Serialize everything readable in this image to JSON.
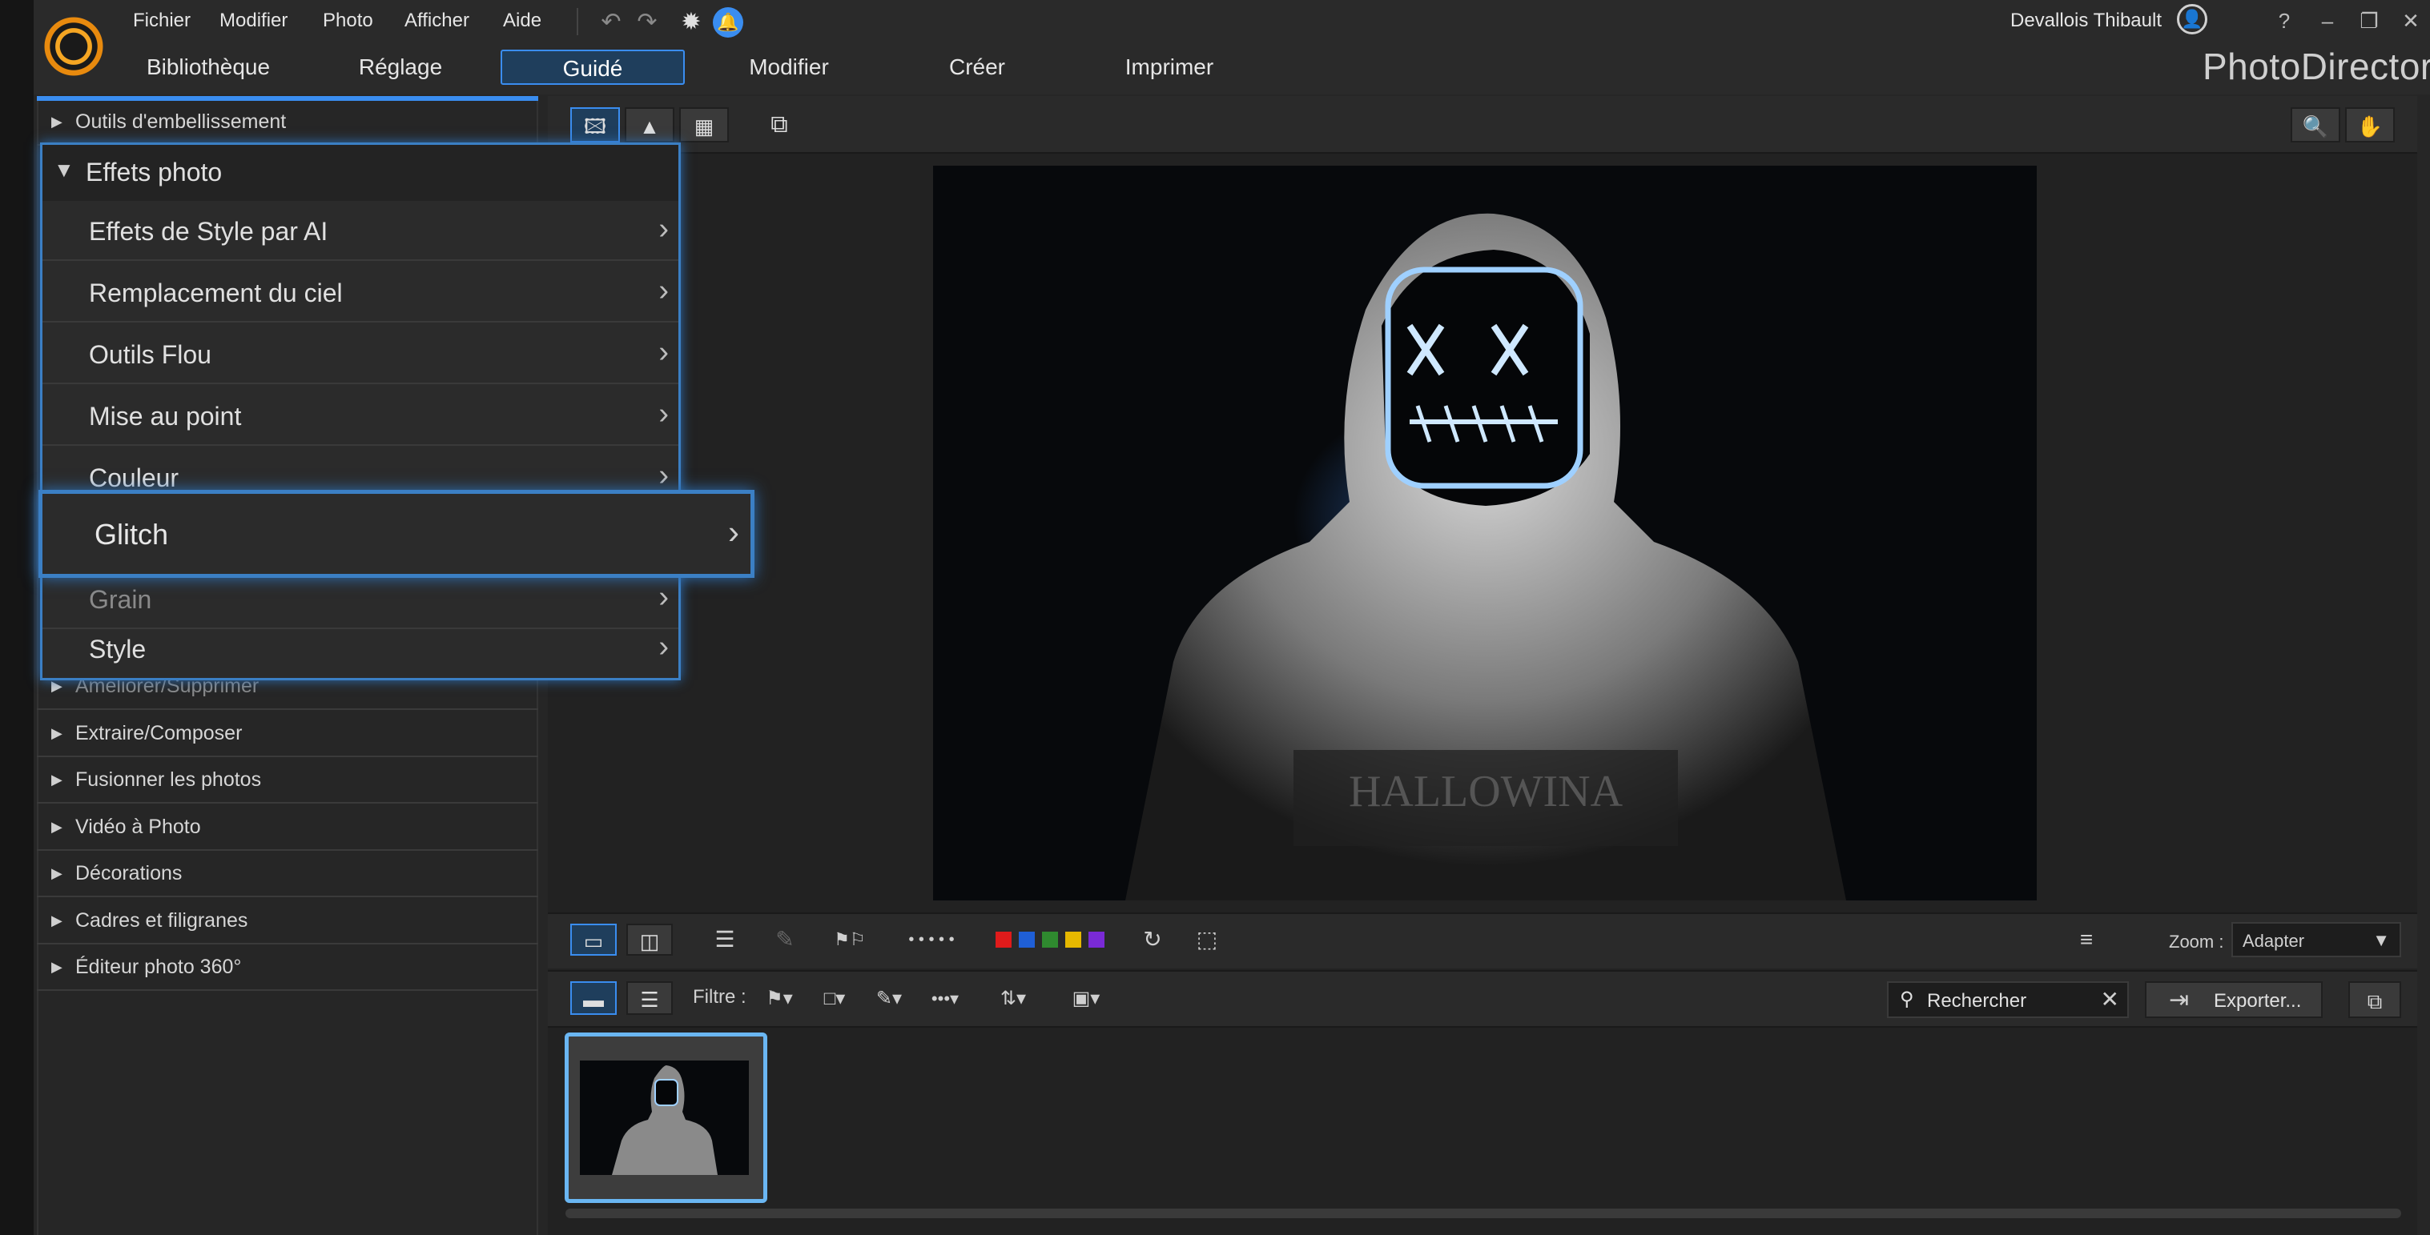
{
  "menubar": {
    "items": [
      "Fichier",
      "Modifier",
      "Photo",
      "Afficher",
      "Aide"
    ],
    "user": "Devallois Thibault",
    "help_icon": "?"
  },
  "tabs": [
    "Bibliothèque",
    "Réglage",
    "Guidé",
    "Modifier",
    "Créer",
    "Imprimer"
  ],
  "active_tab": "Guidé",
  "brand": "PhotoDirector",
  "left_panel": {
    "top_item": "Outils d'embellissement",
    "items": [
      "Améliorer/Supprimer",
      "Extraire/Composer",
      "Fusionner les photos",
      "Vidéo à Photo",
      "Décorations",
      "Cadres et filigranes",
      "Éditeur photo 360°"
    ]
  },
  "popup": {
    "title": "Effets photo",
    "items": [
      "Effets de Style par AI",
      "Remplacement du ciel",
      "Outils Flou",
      "Mise au point",
      "Couleur"
    ],
    "highlighted": "Glitch",
    "after": [
      "Grain",
      "Style"
    ]
  },
  "photo": {
    "shirt_text": "HALLOWINA"
  },
  "toolbar": {
    "zoom_label": "Zoom :",
    "zoom_value": "Adapter",
    "filter_label": "Filtre :",
    "search_placeholder": "Rechercher",
    "export_label": "Exporter...",
    "label_colors": [
      "#e01b1b",
      "#1f5fd6",
      "#2f8a2f",
      "#e6b800",
      "#7a2ad6"
    ]
  }
}
